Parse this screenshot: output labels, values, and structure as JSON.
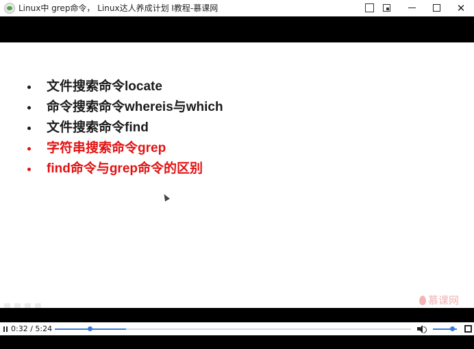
{
  "window": {
    "title": "Linux中 grep命令， Linux达人养成计划 I教程-慕课网",
    "controls": {
      "pin_icon": "pin-icon",
      "mini_player_icon": "mini-player-icon",
      "minimize_glyph": "—",
      "maximize_glyph": "□",
      "close_glyph": "✕"
    }
  },
  "slide": {
    "bullets": [
      {
        "text": "文件搜索命令locate",
        "color": "#1a1a1a"
      },
      {
        "text": "命令搜索命令whereis与which",
        "color": "#1a1a1a"
      },
      {
        "text": "文件搜索命令find",
        "color": "#1a1a1a"
      },
      {
        "text": "字符串搜索命令grep",
        "color": "#e21010"
      },
      {
        "text": "find命令与grep命令的区别",
        "color": "#e21010"
      }
    ],
    "watermark": "慕课网"
  },
  "player": {
    "current_time": "0:32",
    "duration": "5:24",
    "time_display": "0:32 / 5:24",
    "progress_fraction": 0.0988,
    "buffered_fraction": 0.2,
    "volume_fraction": 0.8,
    "accent_color": "#3a78d8"
  }
}
